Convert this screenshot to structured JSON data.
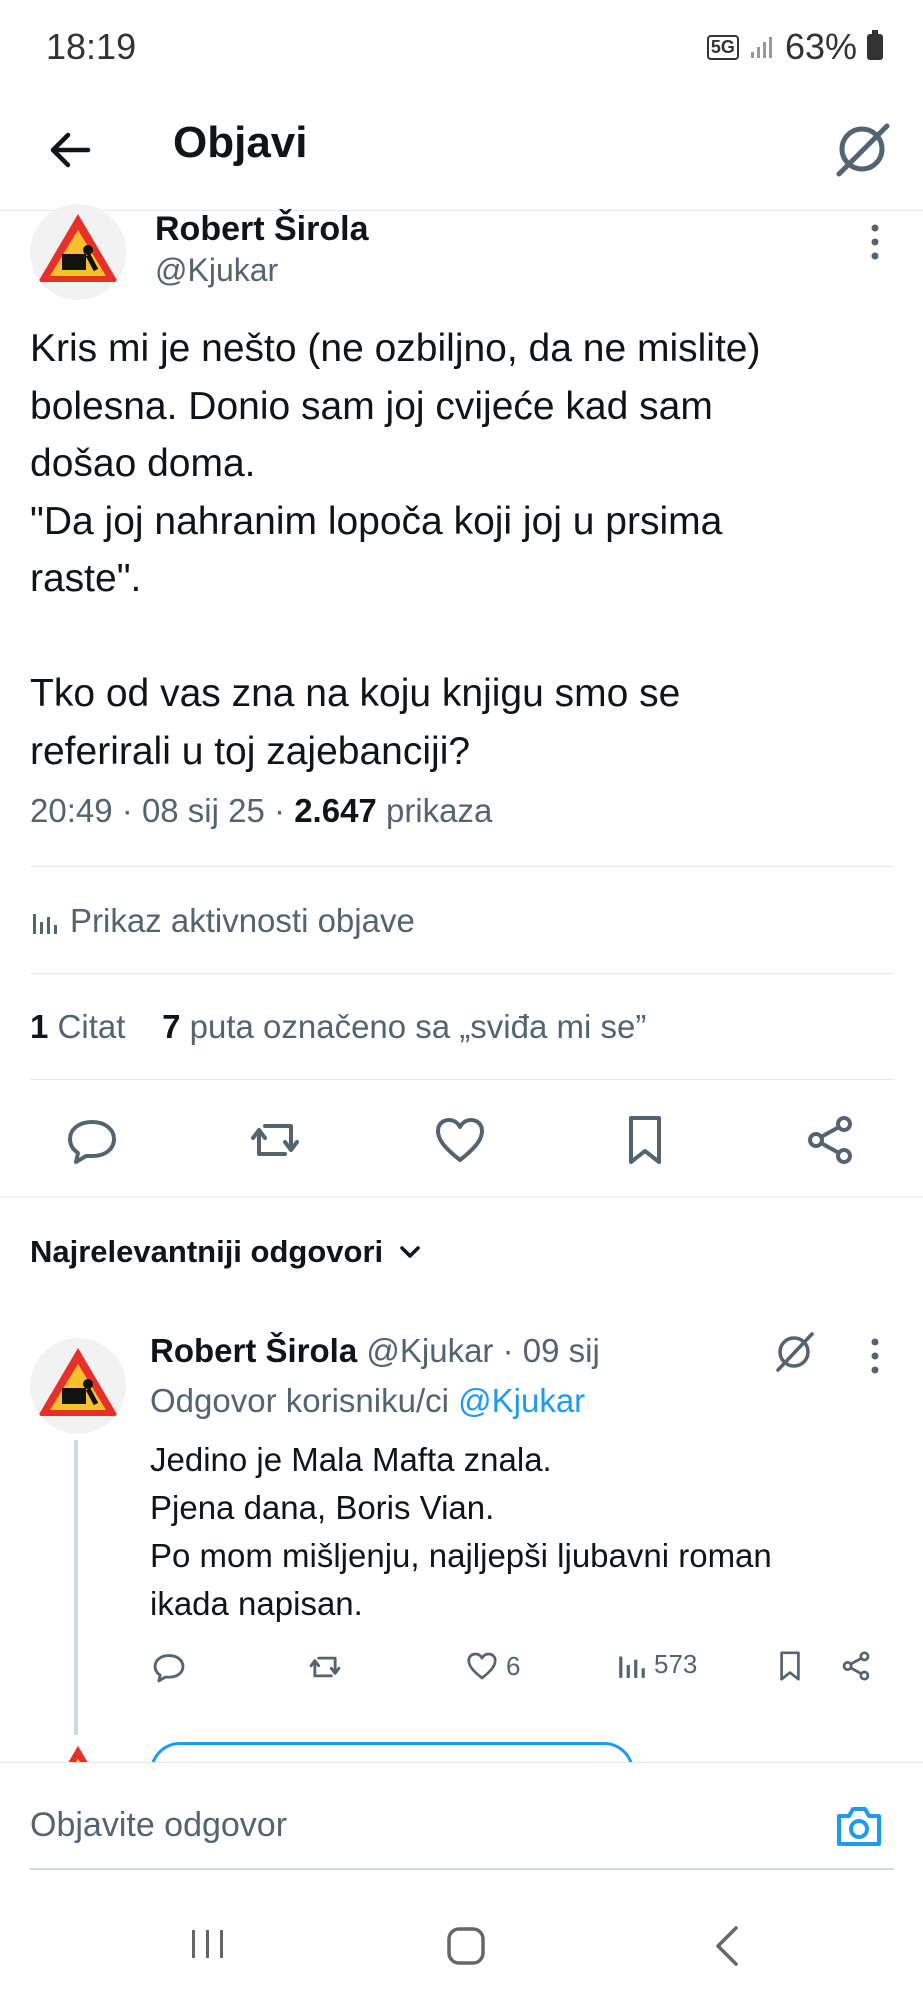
{
  "status": {
    "time": "18:19",
    "network": "5G",
    "battery": "63%"
  },
  "header": {
    "title": "Objavi"
  },
  "post": {
    "author_name": "Robert Širola",
    "author_handle": "@Kjukar",
    "text": "Kris mi je nešto (ne ozbiljno, da ne mislite)\nbolesna. Donio sam joj cvijeće kad sam\ndošao doma.\n\"Da joj nahranim lopoča koji joj u prsima\nraste\".\n\nTko od vas zna na koju knjigu smo se\nreferirali u toj zajebanciji?",
    "time": "20:49",
    "date": "08 sij 25",
    "views": "2.647",
    "views_label": "prikaza",
    "activity_label": "Prikaz aktivnosti objave",
    "quotes_count": "1",
    "quotes_label": "Citat",
    "likes_count": "7",
    "likes_label": "puta označeno sa „sviđa mi se”"
  },
  "replies": {
    "sort_label": "Najrelevantniji odgovori",
    "items": [
      {
        "author_name": "Robert Širola",
        "author_handle": "@Kjukar",
        "date": "· 09 sij",
        "reply_to_label": "Odgovor korisniku/ci",
        "reply_to_handle": "@Kjukar",
        "text": "Jedino je Mala Mafta znala.\nPjena dana, Boris Vian.\nPo mom mišljenju, najljepši ljubavni roman\nikada napisan.",
        "likes": "6",
        "views": "573"
      }
    ]
  },
  "compose": {
    "placeholder": "Objavite odgovor"
  },
  "colors": {
    "accent": "#1d9bf0",
    "secondary_text": "#536471",
    "primary_text": "#0f1419"
  }
}
